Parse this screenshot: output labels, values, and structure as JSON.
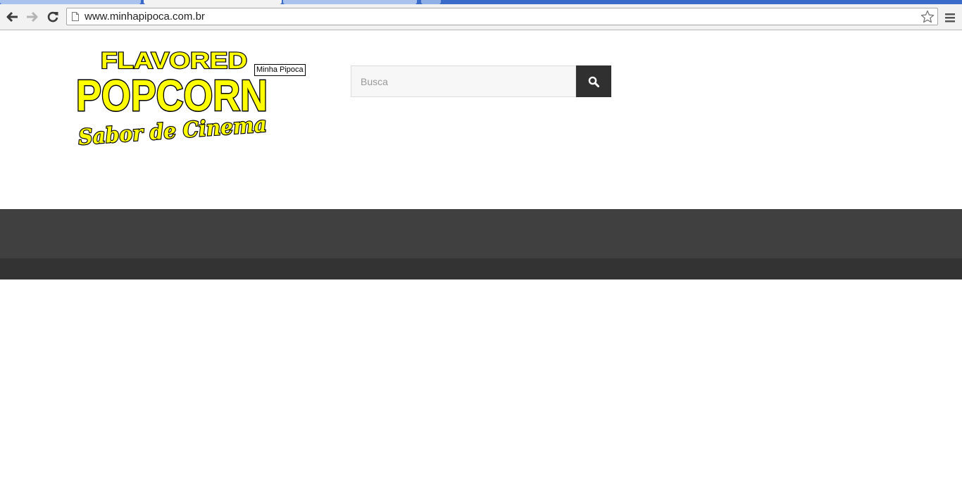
{
  "browser": {
    "url": "www.minhapipoca.com.br"
  },
  "logo": {
    "line1": "FLAVORED",
    "line2": "POPCORN",
    "tagline": "Sabor de Cinema",
    "tooltip": "Minha Pipoca",
    "fill_color": "#ffff00",
    "outline_color": "#000000"
  },
  "search": {
    "placeholder": "Busca",
    "value": ""
  },
  "colors": {
    "nav_bar": "#404040",
    "sub_bar": "#333333",
    "search_button": "#303030"
  },
  "icons": {
    "back": "arrow-left",
    "forward": "arrow-right",
    "reload": "reload",
    "page": "document",
    "bookmark": "star-outline",
    "menu": "hamburger",
    "search": "magnifier"
  }
}
